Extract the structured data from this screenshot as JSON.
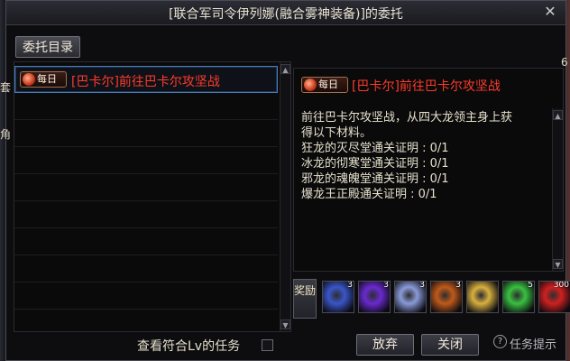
{
  "window": {
    "title": "[联合军司令伊列娜(融合雾神装备)]的委托",
    "close_glyph": "✕"
  },
  "tabs": {
    "commission_list": "委托目录"
  },
  "quest_list": [
    {
      "badge": "每日",
      "label": "[巴卡尔]前往巴卡尔攻坚战",
      "selected": true
    }
  ],
  "detail": {
    "badge": "每日",
    "title": "[巴卡尔]前往巴卡尔攻坚战",
    "description_lines": [
      "前往巴卡尔攻坚战，从四大龙领主身上获",
      "得以下材料。"
    ],
    "requirements": [
      "狂龙的灭尽堂通关证明 : 0/1",
      "冰龙的彻寒堂通关证明 : 0/1",
      "邪龙的魂魄堂通关证明 : 0/1",
      "爆龙王正殿通关证明 : 0/1"
    ]
  },
  "rewards": {
    "label": "奖励",
    "items": [
      {
        "icon": "blue-crystal-icon",
        "count": "3",
        "color": "#3a56c8"
      },
      {
        "icon": "purple-crystal-icon",
        "count": "3",
        "color": "#6a2ad0"
      },
      {
        "icon": "silver-crystal-icon",
        "count": "3",
        "color": "#8a9ad8"
      },
      {
        "icon": "dragon-scale-icon",
        "count": "3",
        "color": "#c05a1a"
      },
      {
        "icon": "gold-coin-icon",
        "count": "",
        "color": "#d8b040"
      },
      {
        "icon": "green-orb-icon",
        "count": "5",
        "color": "#3ac040"
      },
      {
        "icon": "red-gem-icon",
        "count": "300",
        "color": "#d02020"
      }
    ]
  },
  "footer": {
    "filter_label": "查看符合Lv的任务",
    "abandon_label": "放弃",
    "close_label": "关闭",
    "hint_label": "任务提示"
  },
  "edge_marks": {
    "right_top": "6",
    "left_a": "套",
    "left_b": "角"
  },
  "colors": {
    "quest_red": "#ff3a2a",
    "selection_blue": "#4a7ab0"
  }
}
